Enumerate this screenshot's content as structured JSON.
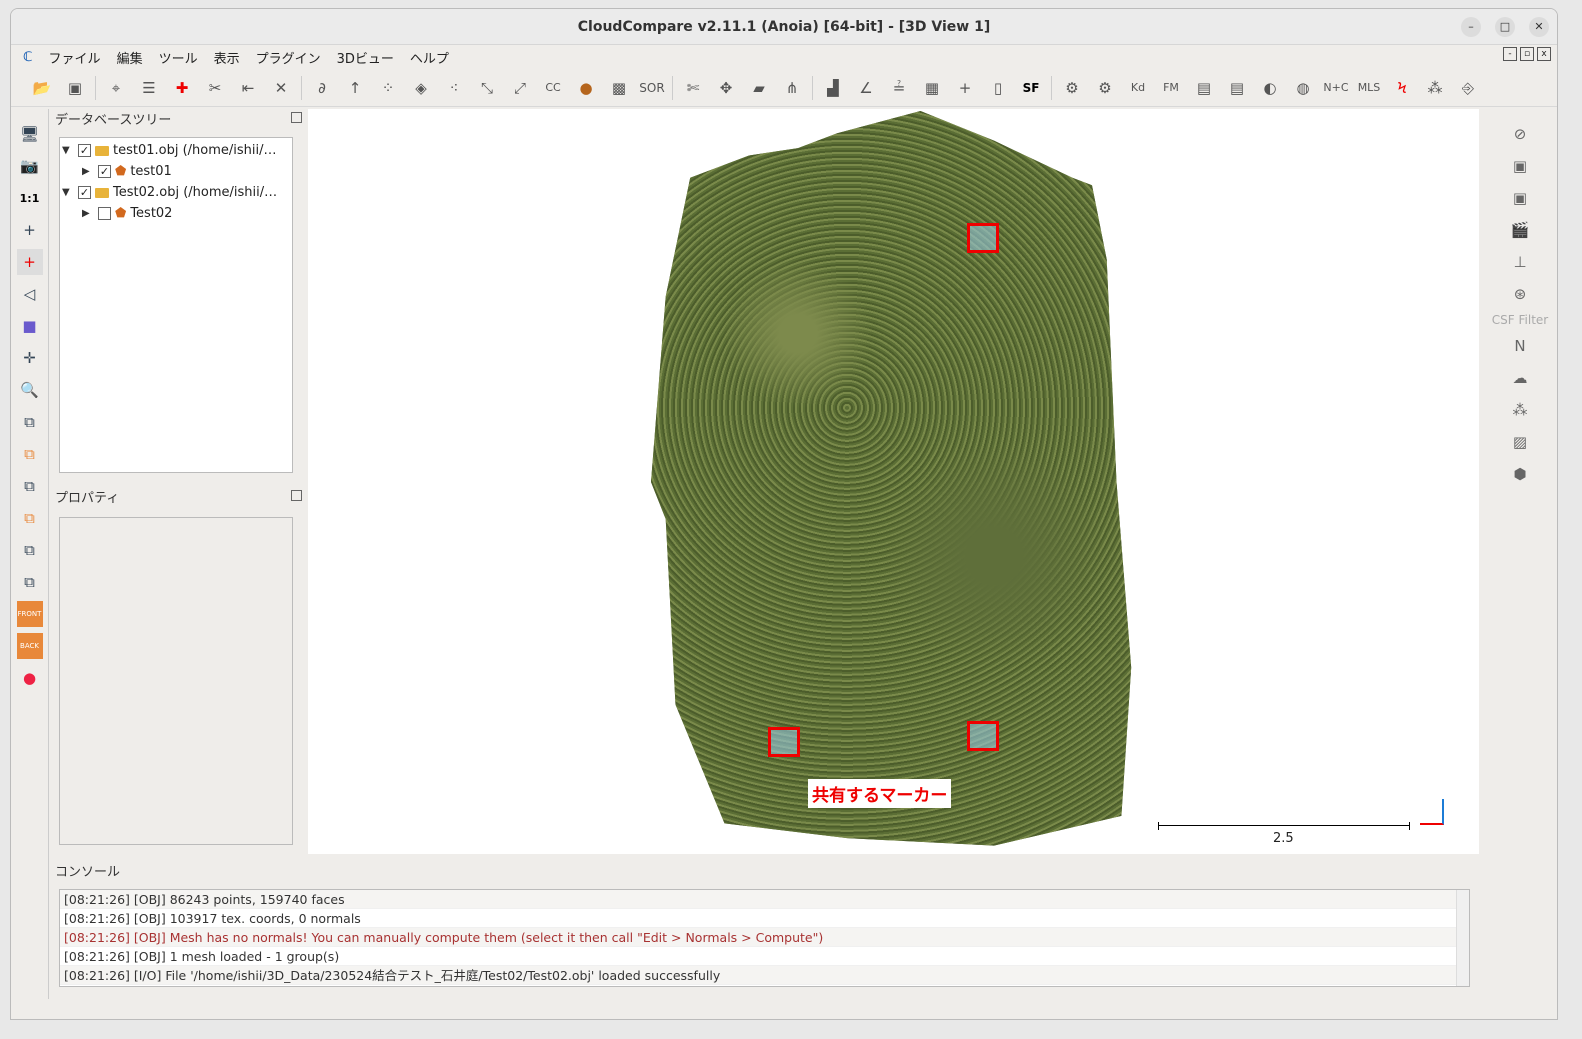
{
  "title": "CloudCompare v2.11.1 (Anoia) [64-bit] - [3D View 1]",
  "menu": [
    "ファイル",
    "編集",
    "ツール",
    "表示",
    "プラグイン",
    "3Dビュー",
    "ヘルプ"
  ],
  "db_tree": {
    "title": "データベースツリー",
    "items": [
      {
        "label": "test01.obj (/home/ishii/…",
        "checked": "✓",
        "level": 0
      },
      {
        "label": "test01",
        "checked": "✓",
        "level": 1
      },
      {
        "label": "Test02.obj (/home/ishii/…",
        "checked": "✓",
        "level": 0
      },
      {
        "label": "Test02",
        "checked": "",
        "level": 1
      }
    ]
  },
  "properties": {
    "title": "プロパティ"
  },
  "view": {
    "annotation": "共有するマーカー",
    "scale_label": "2.5"
  },
  "right_bar": {
    "csf_label": "CSF Filter",
    "north": "N"
  },
  "left_bar": {
    "one_to_one": "1:1",
    "front": "FRONT",
    "back": "BACK"
  },
  "toolbar": {
    "cc": "CC",
    "sor": "SOR",
    "sf": "SF",
    "kd": "Kd",
    "fm": "FM",
    "nc": "N+C",
    "mls": "MLS"
  },
  "console": {
    "title": "コンソール",
    "lines": [
      "[08:21:26] [OBJ] 86243 points, 159740 faces",
      "[08:21:26] [OBJ] 103917 tex. coords, 0 normals",
      "[08:21:26] [OBJ] Mesh has no normals! You can manually compute them (select it then call \"Edit > Normals > Compute\")",
      "[08:21:26] [OBJ] 1 mesh loaded - 1 group(s)",
      "[08:21:26] [I/O] File '/home/ishii/3D_Data/230524結合テスト_石井庭/Test02/Test02.obj' loaded successfully"
    ]
  }
}
